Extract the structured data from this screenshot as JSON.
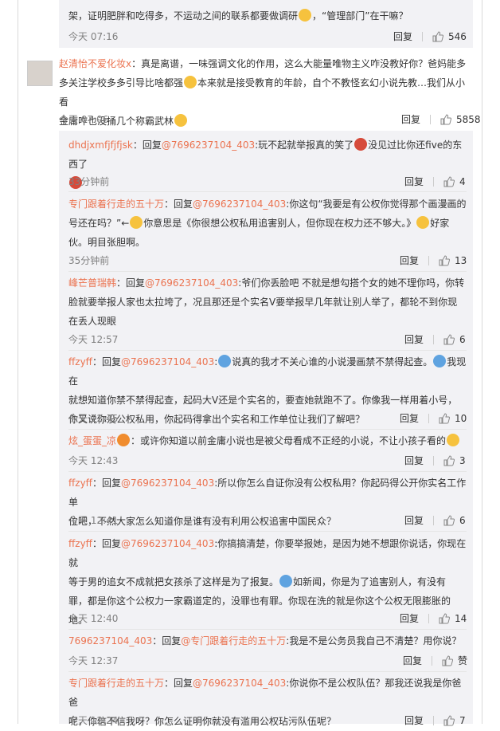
{
  "top_partial": {
    "line1": "架，证明肥胖和吃得多，不运动之间的联系都要做调研",
    "line1_tail": "，“管理部门”在干嘛？",
    "time": "今天 07:16",
    "reply": "回复",
    "likes": "546"
  },
  "main_comment": {
    "user": "赵清怡不爱化妆x",
    "line1": "：真是离谱，一味强调文化的作用，这么大能量唯物主义咋没教好你？爸妈能多",
    "line2": "多关注学校多多引导比啥都强",
    "line2b": "本来就是接受教育的年龄，自个不教怪玄幻小说先教…我们从小看",
    "line3": "金庸咋也没捅几个称霸武林",
    "time": "今天 07:06",
    "reply": "回复",
    "likes": "5858"
  },
  "replies": [
    {
      "user": "dhdjxmfjfjfjsk",
      "pre": "：回复",
      "at": "@7696237104_403",
      "text1": ":玩不起就举报真的笑了",
      "text1b": "没见过比你还five的东西了",
      "time": "33分钟前",
      "reply": "回复",
      "likes": "4"
    },
    {
      "user": "专门跟着行走的五十万",
      "pre": "：回复",
      "at": "@7696237104_403",
      "text1": ":你这句“我要是有公权你觉得那个画漫画的",
      "text2": "号还在吗？”←",
      "text2b": "你意思是《你很想公权私用追害别人，但你现在权力还不够大。》",
      "text2c": "好家",
      "text3": "伙。明目张胆啊。",
      "time": "35分钟前",
      "reply": "回复",
      "likes": "13"
    },
    {
      "user": "峰芒普瑞韩",
      "pre": "：回复",
      "at": "@7696237104_403",
      "text1": ":爷们你丢脸吧 不就是想勾搭个女的她不理你吗，你转",
      "text2": "脸就要举报人家也太拉垮了，况且那还是个实名V要举报早几年就让别人举了，都轮不到你现",
      "text3": "在丢人现眼",
      "time": "今天 12:57",
      "reply": "回复",
      "likes": "6"
    },
    {
      "user": "ffzyff",
      "pre": "：回复",
      "at": "@7696237104_403",
      "text1": ":",
      "text1b": "说真的我才不关心谁的小说漫画禁不禁得起查。",
      "text1c": "我现在",
      "text2": "就想知道你禁不禁得起查，起码大V还是个实名的，要查她就跑不了。你像我一样用着小号，",
      "text3": "你又说你没公权私用，你起码得拿出个实名和工作单位让我们了解吧？",
      "time": "今天 12:45",
      "reply": "回复",
      "likes": "10"
    },
    {
      "user": "炫_蛋蛋_凉",
      "pre": "：或许你知道以前金庸小说也是被父母看成不正经的小说，不让小孩子看的",
      "time": "今天 12:43",
      "reply": "回复",
      "likes": "3"
    },
    {
      "user": "ffzyff",
      "pre": "：回复",
      "at": "@7696237104_403",
      "text1": ":所以你怎么自证你没有公权私用？你起码得公开你实名工作单",
      "text2": "位吧，不然大家怎么知道你是谁有没有利用公权追害中国民众？",
      "time": "今天 12:41",
      "reply": "回复",
      "likes": "6"
    },
    {
      "user": "ffzyff",
      "pre": "：回复",
      "at": "@7696237104_403",
      "text1": ":你搞搞清楚，你要举报她，是因为她不想跟你说话，你现在就",
      "text2": "等于男的追女不成就把女孩杀了这样是为了报复。",
      "text2b": "如新闻，你是为了追害别人，有没有",
      "text3": "罪，都是你这个公权力一家霸道定的，没罪也有罪。你现在洗的就是你这个公权无限膨胀的",
      "text4": "地。",
      "time": "今天 12:40",
      "reply": "回复",
      "likes": "14"
    },
    {
      "user": "7696237104_403",
      "pre": "：回复",
      "at": "@专门跟着行走的五十万",
      "text1": ":我是不是公务员我自己不清楚？用你说？",
      "time": "今天 12:37",
      "reply": "回复",
      "likes": "赞"
    },
    {
      "user": "专门跟着行走的五十万",
      "pre": "：回复",
      "at": "@7696237104_403",
      "text1": ":你说你不是公权队伍？那我还说我是你爸爸",
      "text2": "呢，你信不信我呀？你怎么证明你就没有滥用公权玷污队伍呢？",
      "time": "今天 12:24",
      "reply": "回复",
      "likes": "7"
    }
  ]
}
